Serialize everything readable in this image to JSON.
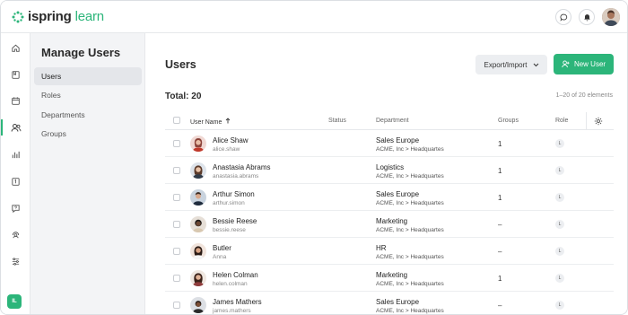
{
  "brand": {
    "name_part1": "ispring",
    "name_part2": "learn"
  },
  "sidebar": {
    "title": "Manage Users",
    "items": [
      {
        "label": "Users",
        "active": true
      },
      {
        "label": "Roles",
        "active": false
      },
      {
        "label": "Departments",
        "active": false
      },
      {
        "label": "Groups",
        "active": false
      }
    ]
  },
  "rail": {
    "icons": [
      "home-icon",
      "book-icon",
      "calendar-icon",
      "users-icon",
      "chart-icon",
      "page-icon",
      "help-icon",
      "support-icon",
      "settings-icon"
    ],
    "badge": "IL"
  },
  "main": {
    "title": "Users",
    "export_label": "Export/Import",
    "new_user_label": "New User",
    "total_label": "Total: 20",
    "range_label": "1–20 of 20 elements",
    "columns": {
      "name": "User Name",
      "status": "Status",
      "department": "Department",
      "groups": "Groups",
      "role": "Role"
    }
  },
  "users": [
    {
      "name": "Alice Shaw",
      "login": "alice.shaw",
      "dept": "Sales Europe",
      "dept_path": "ACME, Inc > Headquartes",
      "groups": "1",
      "role": "L"
    },
    {
      "name": "Anastasia Abrams",
      "login": "anastasia.abrams",
      "dept": "Logistics",
      "dept_path": "ACME, Inc > Headquartes",
      "groups": "1",
      "role": "L"
    },
    {
      "name": "Arthur Simon",
      "login": "arthur.simon",
      "dept": "Sales Europe",
      "dept_path": "ACME, Inc > Headquartes",
      "groups": "1",
      "role": "L"
    },
    {
      "name": "Bessie Reese",
      "login": "bessie.reese",
      "dept": "Marketing",
      "dept_path": "ACME, Inc > Headquartes",
      "groups": "–",
      "role": "L"
    },
    {
      "name": "Butler",
      "login": "Anna",
      "dept": "HR",
      "dept_path": "ACME, Inc > Headquartes",
      "groups": "–",
      "role": "L"
    },
    {
      "name": "Helen Colman",
      "login": "helen.colman",
      "dept": "Marketing",
      "dept_path": "ACME, Inc > Headquartes",
      "groups": "1",
      "role": "L"
    },
    {
      "name": "James Mathers",
      "login": "james.mathers",
      "dept": "Sales Europe",
      "dept_path": "ACME, Inc > Headquartes",
      "groups": "–",
      "role": "L"
    }
  ],
  "colors": {
    "accent": "#2cb57a",
    "sidebar_bg": "#f3f4f6"
  }
}
